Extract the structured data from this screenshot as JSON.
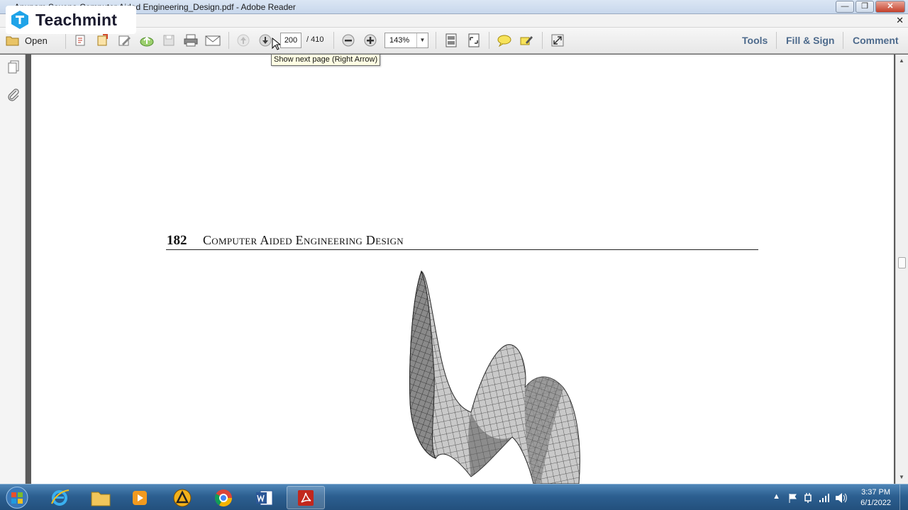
{
  "window": {
    "title": "Anupam Saxena Computer Aided Engineering_Design.pdf - Adobe Reader",
    "min_glyph": "—",
    "max_glyph": "❐",
    "close_glyph": "✕",
    "doc_close_glyph": "✕"
  },
  "watermark": {
    "text": "Teachmint"
  },
  "toolbar": {
    "open_label": "Open",
    "current_page": "200",
    "total_pages": "/ 410",
    "zoom": "143%",
    "zoom_arrow": "▼",
    "tools_label": "Tools",
    "fill_sign_label": "Fill & Sign",
    "comment_label": "Comment",
    "icons": [
      "open-folder-icon",
      "create-pdf-icon",
      "export-icon",
      "edit-icon",
      "upload-icon",
      "save-icon",
      "print-icon",
      "email-icon",
      "previous-page-icon",
      "next-page-icon",
      "zoom-out-icon",
      "zoom-in-icon",
      "fit-page-icon",
      "fit-width-icon",
      "sticky-note-icon",
      "highlight-icon",
      "expand-icon"
    ]
  },
  "tooltip": {
    "text": "Show next page (Right Arrow)"
  },
  "leftnav": {
    "icons": [
      "pages-panel-icon",
      "attachments-icon"
    ]
  },
  "document": {
    "page_number": "182",
    "running_header": "Computer Aided Engineering Design"
  },
  "scrollbar": {
    "up": "▲",
    "down": "▼"
  },
  "taskbar": {
    "apps": [
      "windows-start-icon",
      "internet-explorer-icon",
      "file-explorer-icon",
      "media-player-icon",
      "autocad-icon",
      "chrome-icon",
      "word-icon",
      "adobe-reader-icon"
    ],
    "active_app": "adobe-reader-icon",
    "tray_arrow": "▲",
    "time": "3:37 PM",
    "date": "6/1/2022"
  }
}
